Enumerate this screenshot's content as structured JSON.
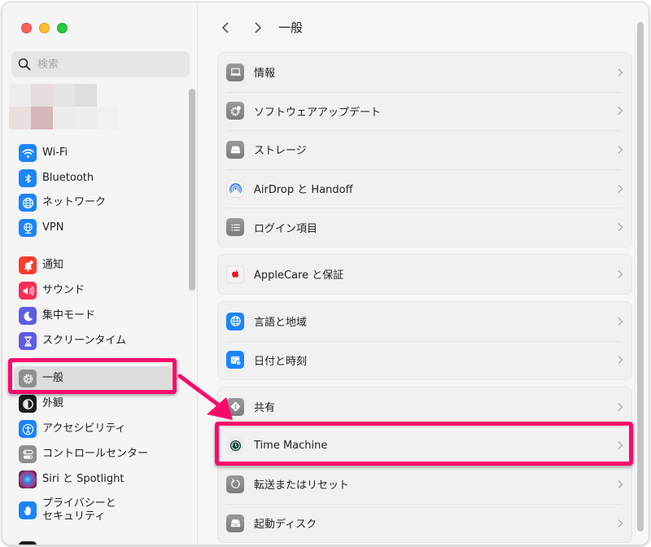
{
  "window": {
    "traffic_lights": {
      "close": "close-button",
      "minimize": "minimize-button",
      "zoom": "zoom-button"
    }
  },
  "sidebar": {
    "search": {
      "placeholder": "検索",
      "value": ""
    },
    "groups": [
      [
        {
          "id": "wifi",
          "label": "Wi-Fi",
          "icon": "wifi-icon",
          "color": "#1b84ff"
        },
        {
          "id": "bluetooth",
          "label": "Bluetooth",
          "icon": "bluetooth-icon",
          "color": "#1b84ff"
        },
        {
          "id": "network",
          "label": "ネットワーク",
          "icon": "globe-icon",
          "color": "#1b84ff"
        },
        {
          "id": "vpn",
          "label": "VPN",
          "icon": "vpn-globe-icon",
          "color": "#1b84ff"
        }
      ],
      [
        {
          "id": "notifications",
          "label": "通知",
          "icon": "bell-icon",
          "color": "#fe3b30"
        },
        {
          "id": "sound",
          "label": "サウンド",
          "icon": "speaker-icon",
          "color": "#fe2d55"
        },
        {
          "id": "focus",
          "label": "集中モード",
          "icon": "moon-icon",
          "color": "#5e5ce6"
        },
        {
          "id": "screen-time",
          "label": "スクリーンタイム",
          "icon": "hourglass-icon",
          "color": "#5e5ce6"
        }
      ],
      [
        {
          "id": "general",
          "label": "一般",
          "icon": "gear-icon",
          "color": "#8e8e93",
          "selected": true
        },
        {
          "id": "appearance",
          "label": "外観",
          "icon": "appearance-icon",
          "color": "#1c1c1e"
        },
        {
          "id": "accessibility",
          "label": "アクセシビリティ",
          "icon": "accessibility-icon",
          "color": "#1b84ff"
        },
        {
          "id": "control-center",
          "label": "コントロールセンター",
          "icon": "toggles-icon",
          "color": "#8e8e93"
        },
        {
          "id": "siri",
          "label": "Siri と Spotlight",
          "icon": "siri-icon",
          "color": "#2b2b2b"
        },
        {
          "id": "privacy",
          "label": "プライバシーと\nセキュリティ",
          "label_line1": "プライバシーと",
          "label_line2": "セキュリティ",
          "icon": "hand-icon",
          "color": "#1b84ff"
        }
      ]
    ]
  },
  "main": {
    "title": "一般",
    "nav": {
      "back": "back-button",
      "forward": "forward-button"
    },
    "groups": [
      [
        {
          "id": "about",
          "label": "情報",
          "icon": "laptop-icon"
        },
        {
          "id": "software-update",
          "label": "ソフトウェアアップデート",
          "icon": "software-update-gear-icon"
        },
        {
          "id": "storage",
          "label": "ストレージ",
          "icon": "storage-drive-icon"
        },
        {
          "id": "airdrop",
          "label": "AirDrop と Handoff",
          "icon": "airdrop-icon"
        },
        {
          "id": "login-items",
          "label": "ログイン項目",
          "icon": "list-icon"
        }
      ],
      [
        {
          "id": "applecare",
          "label": "AppleCare と保証",
          "icon": "apple-logo-icon"
        }
      ],
      [
        {
          "id": "language-region",
          "label": "言語と地域",
          "icon": "globe-icon"
        },
        {
          "id": "date-time",
          "label": "日付と時刻",
          "icon": "calendar-clock-icon"
        }
      ],
      [
        {
          "id": "sharing",
          "label": "共有",
          "icon": "sharing-icon"
        },
        {
          "id": "time-machine",
          "label": "Time Machine",
          "icon": "time-machine-icon",
          "highlighted": true
        },
        {
          "id": "transfer-reset",
          "label": "転送またはリセット",
          "icon": "reset-arrow-icon"
        },
        {
          "id": "startup-disk",
          "label": "起動ディスク",
          "icon": "startup-disk-icon"
        }
      ]
    ]
  },
  "annotations": {
    "highlight_color": "#fb0a6a",
    "boxes": [
      "sidebar-item-general",
      "row-time-machine"
    ],
    "arrow": "from sidebar general item to Time Machine row"
  }
}
